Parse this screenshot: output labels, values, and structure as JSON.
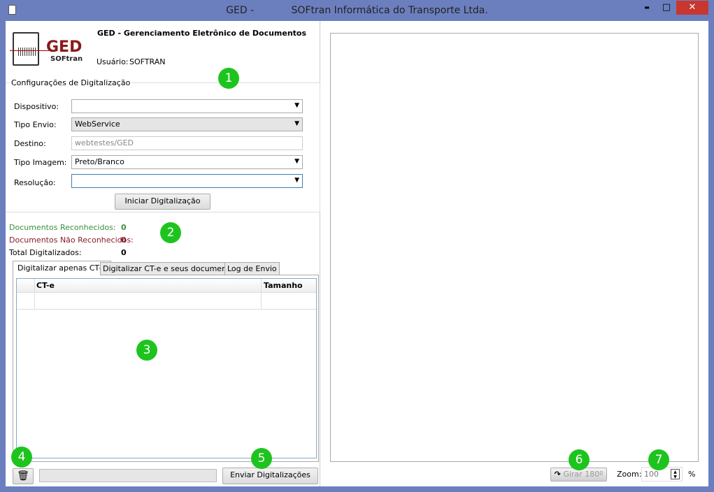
{
  "window": {
    "title": "GED -            SOFtran Informática do Transporte Ltda.",
    "minimize": "▬",
    "maximize": "□",
    "close": "✕"
  },
  "header": {
    "logo_text": "GED",
    "logo_sub": "SOFtran",
    "app_name": "GED - Gerenciamento Eletrônico de Documentos",
    "user_label": "Usuário:",
    "user_value": "SOFTRAN"
  },
  "config": {
    "title": "Configurações de Digitalização",
    "dispositivo_label": "Dispositivo:",
    "dispositivo_value": "",
    "tipo_envio_label": "Tipo Envio:",
    "tipo_envio_value": "WebService",
    "destino_label": "Destino:",
    "destino_value": "webtestes/GED",
    "tipo_imagem_label": "Tipo Imagem:",
    "tipo_imagem_value": "Preto/Branco",
    "resolucao_label": "Resolução:",
    "resolucao_value": "",
    "start_button": "Iniciar Digitalização"
  },
  "stats": {
    "reconhecidos_label": "Documentos Reconhecidos:",
    "reconhecidos_value": "0",
    "nao_label": "Documentos Não Reconhecidos:",
    "nao_value": "0",
    "total_label": "Total Digitalizados:",
    "total_value": "0",
    "colors": {
      "green": "#3c8f3c",
      "red": "#8b1a2b"
    }
  },
  "tabs": [
    "Digitalizar apenas CT-e",
    "Digitalizar CT-e e seus documentos",
    "Log de Envio"
  ],
  "table": {
    "columns": [
      "CT-e",
      "Tamanho"
    ]
  },
  "footer": {
    "send_button": "Enviar Digitalizações",
    "rotate_button": "Girar 180º",
    "zoom_label": "Zoom:",
    "zoom_value": "100",
    "zoom_unit": "%"
  },
  "badges": [
    "1",
    "2",
    "3",
    "4",
    "5",
    "6",
    "7"
  ]
}
